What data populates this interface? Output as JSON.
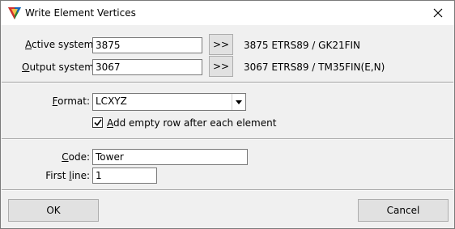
{
  "window": {
    "title": "Write Element Vertices",
    "app_icon": "microstation-triangle-icon",
    "close_icon": "close-icon"
  },
  "systems": {
    "active_label_pre": "",
    "active_label_u": "A",
    "active_label_post": "ctive system:",
    "active_value": "3875",
    "active_button": ">>",
    "active_description": "3875 ETRS89 / GK21FIN",
    "output_label_pre": "",
    "output_label_u": "O",
    "output_label_post": "utput system:",
    "output_value": "3067",
    "output_button": ">>",
    "output_description": "3067 ETRS89 / TM35FIN(E,N)"
  },
  "format": {
    "label_u": "F",
    "label_post": "ormat:",
    "selected": "LCXYZ",
    "add_empty_row_checked": true,
    "add_empty_row_u": "A",
    "add_empty_row_post": "dd empty row after each element"
  },
  "code": {
    "label_u": "C",
    "label_post": "ode:",
    "value": "Tower",
    "first_line_pre": "First ",
    "first_line_u": "l",
    "first_line_post": "ine:",
    "first_line_value": "1"
  },
  "buttons": {
    "ok": "OK",
    "cancel": "Cancel"
  }
}
